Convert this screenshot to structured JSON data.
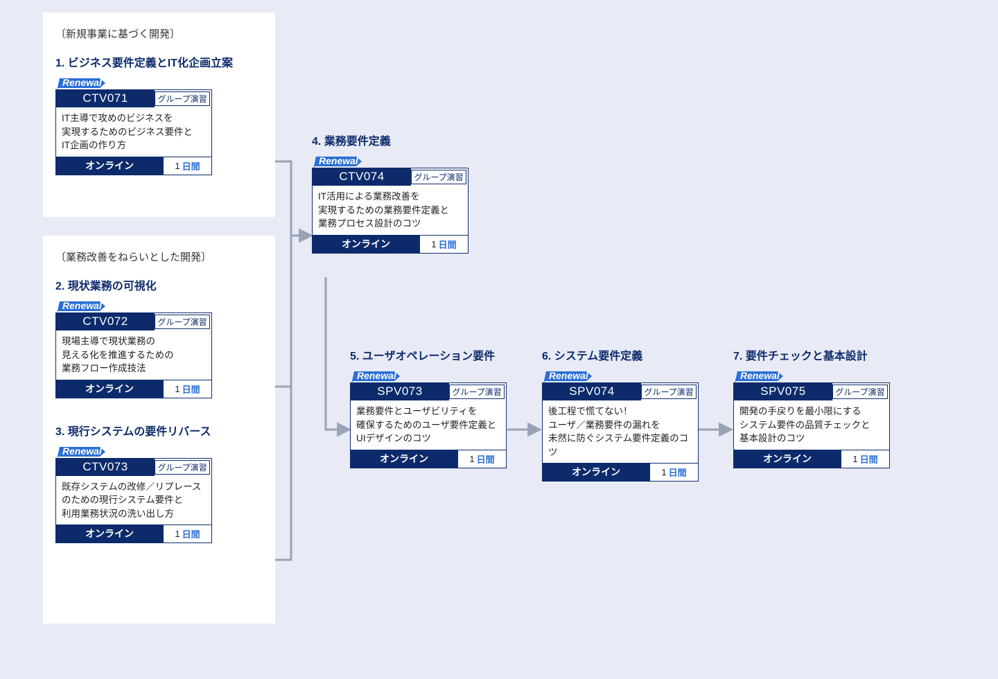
{
  "panel1": {
    "title": "〔新規事業に基づく開発〕",
    "section": "1. ビジネス要件定義とIT化企画立案"
  },
  "panel2": {
    "title": "〔業務改善をねらいとした開発〕",
    "section2": "2. 現状業務の可視化",
    "section3": "3. 現行システムの要件リバース"
  },
  "sec4": "4. 業務要件定義",
  "sec5": "5. ユーザオペレーション要件",
  "sec6": "6. システム要件定義",
  "sec7": "7. 要件チェックと基本設計",
  "badge": {
    "renewal": "Renewal",
    "group": "グループ演習",
    "mode": "オンライン",
    "dur_n": "1",
    "dur_u": "日間"
  },
  "cards": {
    "c1": {
      "code": "CTV071",
      "body": "IT主導で攻めのビジネスを\n実現するためのビジネス要件と\nIT企画の作り方"
    },
    "c2": {
      "code": "CTV072",
      "body": "現場主導で現状業務の\n見える化を推進するための\n業務フロー作成技法"
    },
    "c3": {
      "code": "CTV073",
      "body": "既存システムの改修／リプレース\nのための現行システム要件と\n利用業務状況の洗い出し方"
    },
    "c4": {
      "code": "CTV074",
      "body": "IT活用による業務改善を\n実現するための業務要件定義と\n業務プロセス設計のコツ"
    },
    "c5": {
      "code": "SPV073",
      "body": "業務要件とユーザビリティを\n確保するためのユーザ要件定義と\nUIデザインのコツ"
    },
    "c6": {
      "code": "SPV074",
      "body": "後工程で慌てない！\nユーザ／業務要件の漏れを\n未然に防ぐシステム要件定義のコツ"
    },
    "c7": {
      "code": "SPV075",
      "body": "開発の手戻りを最小限にする\nシステム要件の品質チェックと\n基本設計のコツ"
    }
  }
}
